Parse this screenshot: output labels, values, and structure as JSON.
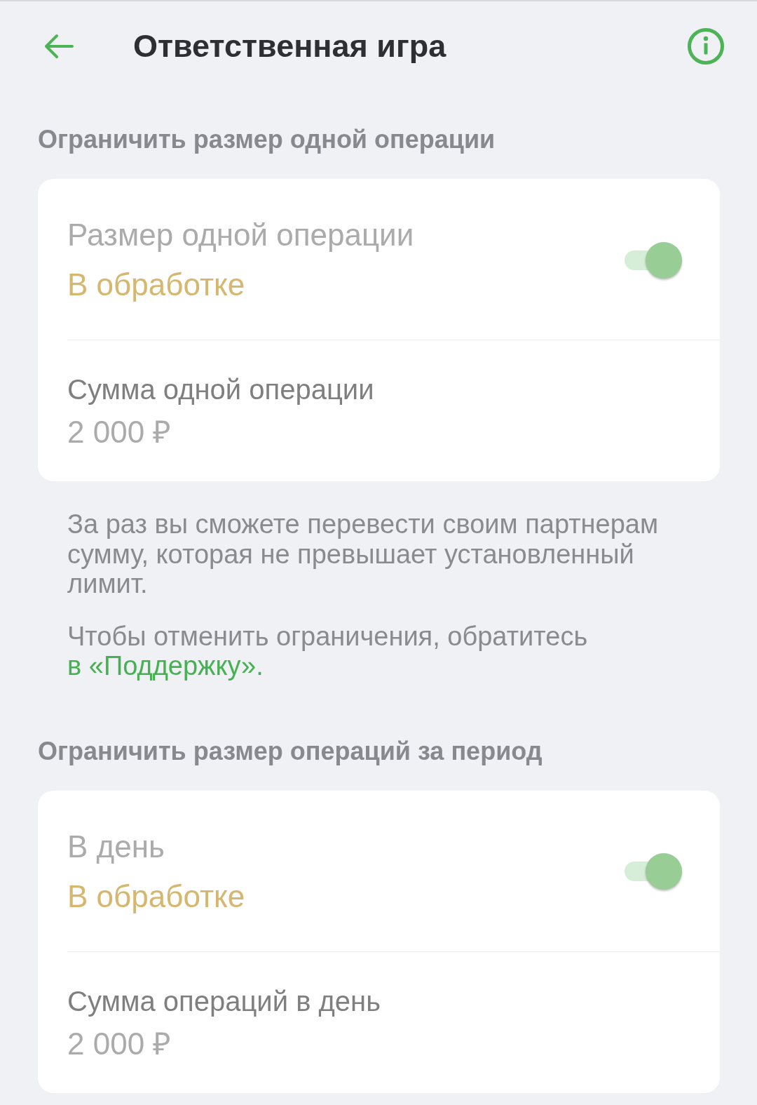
{
  "header": {
    "title": "Ответственная игра"
  },
  "sections": [
    {
      "title": "Ограничить размер одной операции",
      "switch_row": {
        "label": "Размер одной операции",
        "status": "В обработке",
        "on": true
      },
      "amount_row": {
        "label": "Сумма одной операции",
        "value": "2 000 ₽"
      },
      "notes": [
        {
          "text": "За раз вы сможете перевести своим партнерам сумму, которая не превышает установленный лимит."
        },
        {
          "text": "Чтобы отменить ограничения, обратитесь",
          "link": "в «Поддержку»."
        }
      ]
    },
    {
      "title": "Ограничить размер операций за период",
      "switch_row": {
        "label": "В день",
        "status": "В обработке",
        "on": true
      },
      "amount_row": {
        "label": "Сумма операций в день",
        "value": "2 000 ₽"
      }
    }
  ]
}
